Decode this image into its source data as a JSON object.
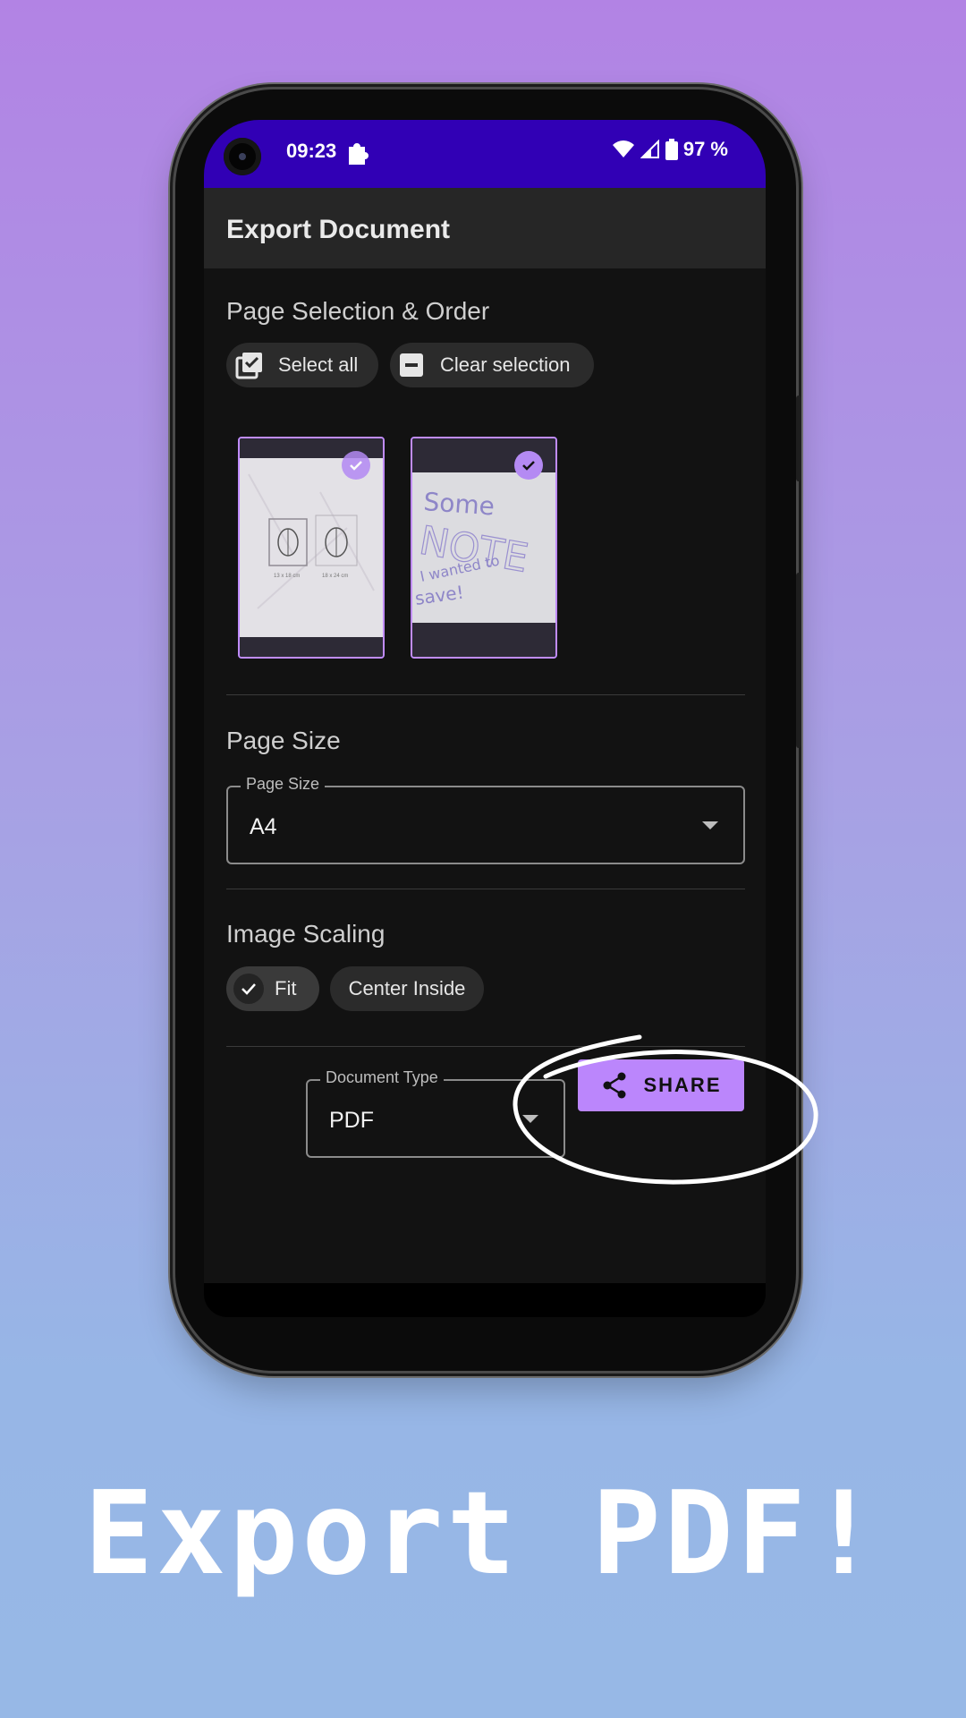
{
  "status_bar": {
    "time": "09:23",
    "battery_text": "97 %",
    "icons": [
      "camera-icon",
      "puzzle-icon",
      "wifi-icon",
      "signal-icon",
      "battery-icon"
    ]
  },
  "app_bar": {
    "title": "Export Document"
  },
  "page_selection": {
    "title": "Page Selection & Order",
    "select_all_label": "Select all",
    "clear_selection_label": "Clear selection",
    "pages": [
      {
        "selected": true,
        "caption_left": "13 x 18 cm",
        "caption_right": "18 x 24 cm"
      },
      {
        "selected": true,
        "lines": [
          "Some",
          "NOTE",
          "I wanted to",
          "save!"
        ]
      }
    ]
  },
  "page_size": {
    "title": "Page Size",
    "field_label": "Page Size",
    "value": "A4"
  },
  "image_scaling": {
    "title": "Image Scaling",
    "options": [
      {
        "label": "Fit",
        "selected": true
      },
      {
        "label": "Center Inside",
        "selected": false
      }
    ]
  },
  "document_type": {
    "field_label": "Document Type",
    "value": "PDF"
  },
  "share_button": {
    "label": "SHARE"
  },
  "headline": "Export PDF!",
  "colors": {
    "accent": "#bb86fc",
    "status_bar": "#3100b5",
    "background": "#121212",
    "app_bar": "#262626"
  }
}
